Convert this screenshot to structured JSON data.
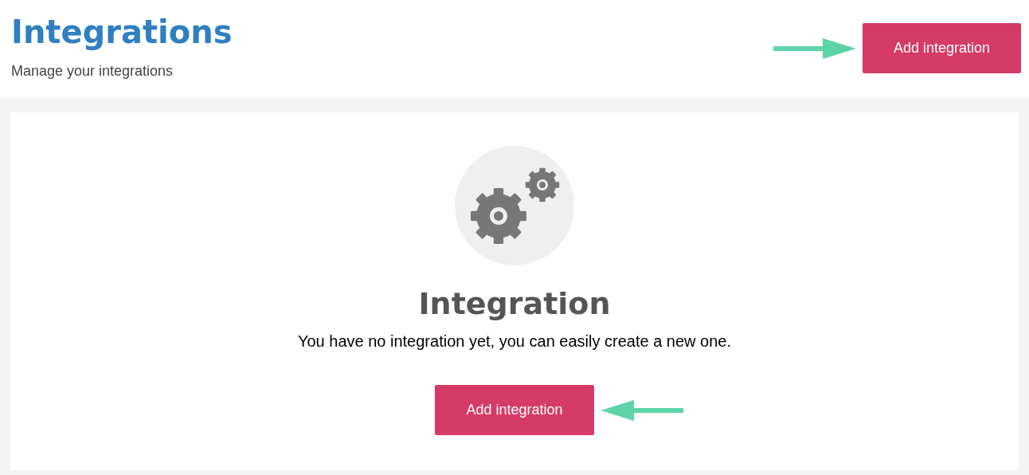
{
  "header": {
    "title": "Integrations",
    "subtitle": "Manage your integrations",
    "button": "Add integration"
  },
  "empty_state": {
    "title": "Integration",
    "message": "You have no integration yet, you can easily create a new one.",
    "button": "Add integration"
  }
}
